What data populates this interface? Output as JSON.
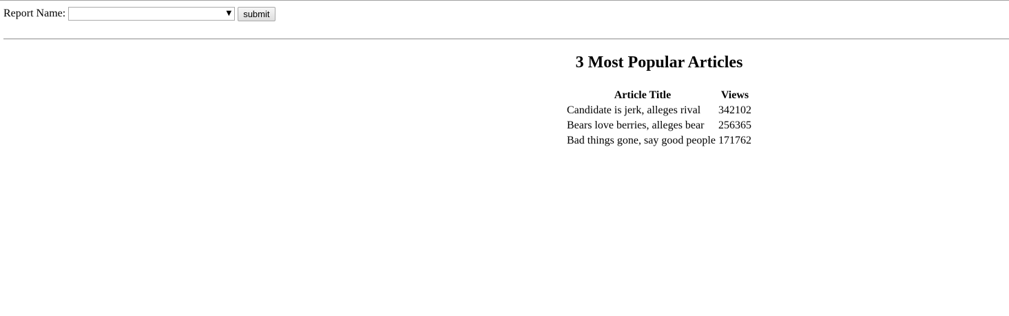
{
  "form": {
    "label": "Report Name:",
    "select_value": "",
    "select_arrow_icon": "dropdown-arrow-icon",
    "submit_label": "submit"
  },
  "report": {
    "title": "3 Most Popular Articles",
    "headers": {
      "title": "Article Title",
      "views": "Views"
    },
    "rows": [
      {
        "title": "Candidate is jerk, alleges rival",
        "views": "342102"
      },
      {
        "title": "Bears love berries, alleges bear",
        "views": "256365"
      },
      {
        "title": "Bad things gone, say good people",
        "views": "171762"
      }
    ]
  }
}
